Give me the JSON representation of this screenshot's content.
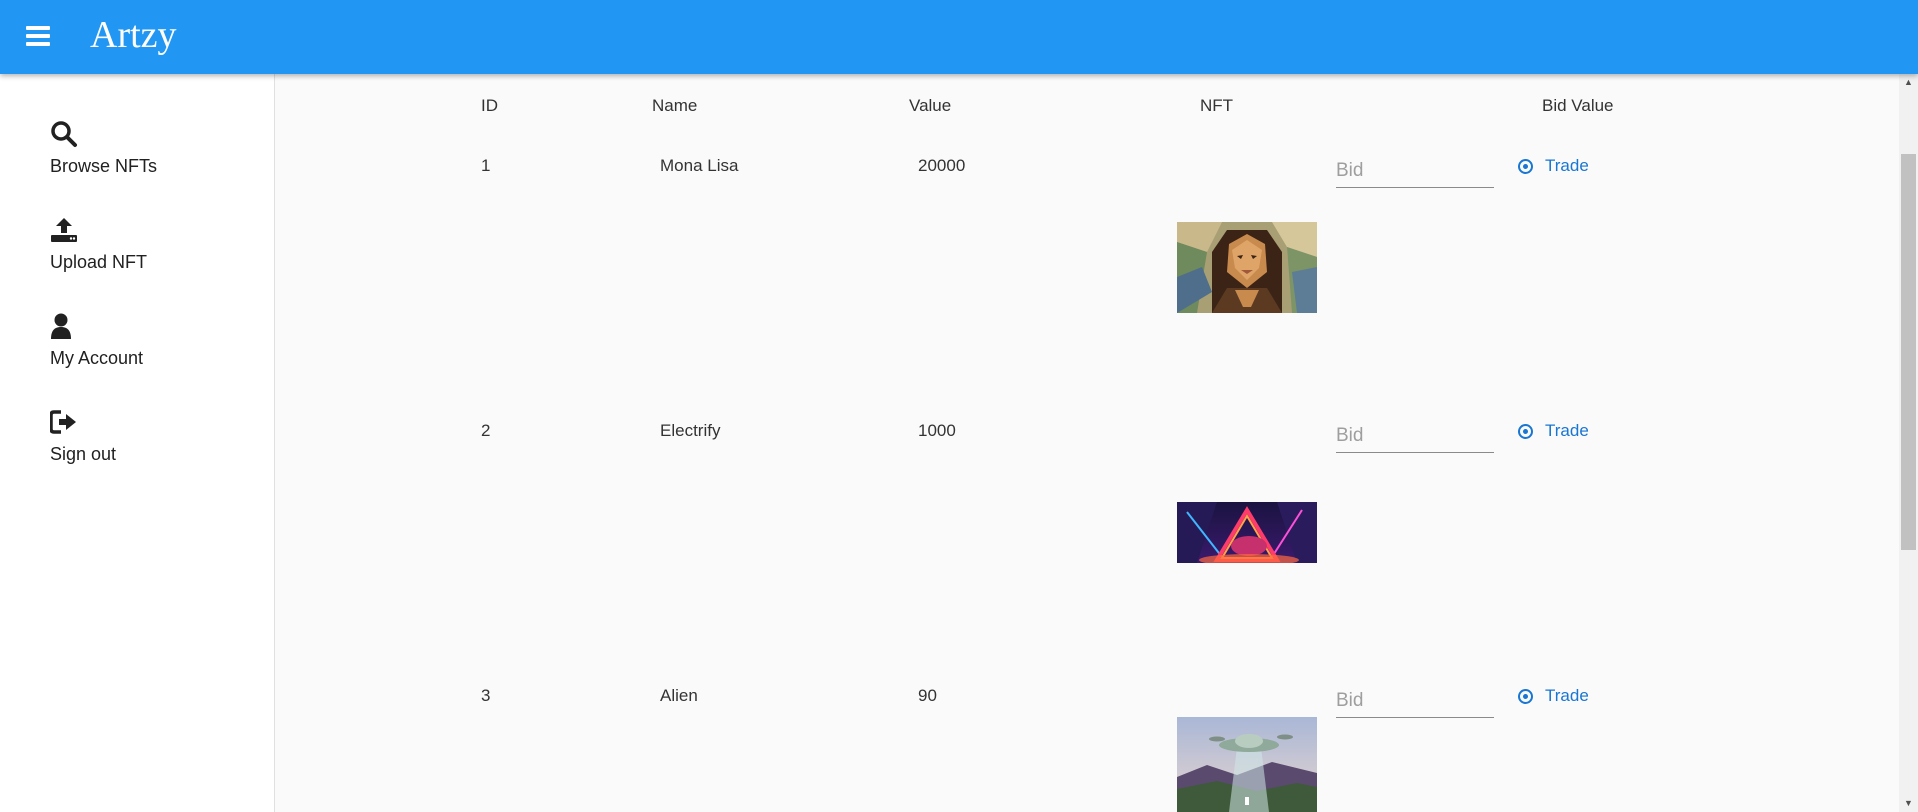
{
  "app": {
    "title": "Artzy"
  },
  "sidebar": {
    "items": [
      {
        "label": "Browse NFTs",
        "icon": "search-icon"
      },
      {
        "label": "Upload NFT",
        "icon": "upload-icon"
      },
      {
        "label": "My Account",
        "icon": "user-icon"
      },
      {
        "label": "Sign out",
        "icon": "sign-out-icon"
      }
    ]
  },
  "table": {
    "headers": {
      "id": "ID",
      "name": "Name",
      "value": "Value",
      "nft": "NFT",
      "bid_value": "Bid Value"
    },
    "rows": [
      {
        "id": "1",
        "name": "Mona Lisa",
        "value": "20000",
        "bid_placeholder": "Bid",
        "trade_label": "Trade",
        "image": "mona-lisa-lowpoly-image"
      },
      {
        "id": "2",
        "name": "Electrify",
        "value": "1000",
        "bid_placeholder": "Bid",
        "trade_label": "Trade",
        "image": "neon-triangle-image"
      },
      {
        "id": "3",
        "name": "Alien",
        "value": "90",
        "bid_placeholder": "Bid",
        "trade_label": "Trade",
        "image": "ufo-landscape-image"
      }
    ]
  },
  "colors": {
    "appbar": "#2196f3",
    "accent": "#1976d2"
  }
}
